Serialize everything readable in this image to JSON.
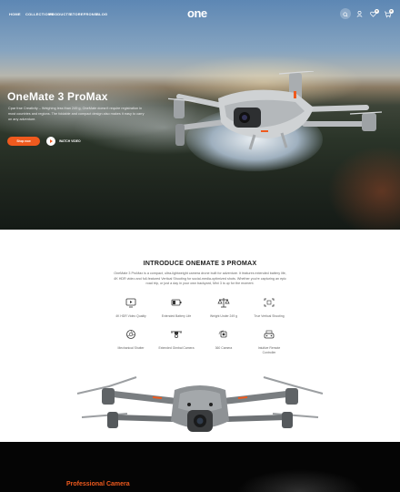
{
  "nav": {
    "links": [
      "Home",
      "Collections",
      "Products",
      "Storefrons",
      "Blog"
    ],
    "logo": "one",
    "wishlist_count": "0",
    "cart_count": "0"
  },
  "hero": {
    "title": "OneMate 3 ProMax",
    "description": "Cpar frae Creativity – Weighing less than 249 g, OneMate doesn't require registration in most countries and regions. The foldable and compact design also makes it easy to carry on any adventure.",
    "shop_button": "Shop now",
    "video_label": "Watch video",
    "slides": 3,
    "active_slide": 0
  },
  "intro": {
    "title": "INTRODUCE ONEMATE 3 PROMAX",
    "description": "OneMate 3 ProMax is a compact, ultra-lightweight camera drone built for adventure. It features extended battery life, 4K HDR video and full-featured Vertical Shooting for social-media-optimized shots. Whether you're capturing an epic road trip, or just a day in your own backyard, Mini 3 is up for the moment.",
    "features": [
      {
        "icon": "video-camera-icon",
        "label": "4K HDR Video Quality"
      },
      {
        "icon": "battery-icon",
        "label": "Extended Battery Life"
      },
      {
        "icon": "scale-icon",
        "label": "Weight Under 249 g"
      },
      {
        "icon": "frame-icon",
        "label": "True Vertical Shooting"
      },
      {
        "icon": "aperture-icon",
        "label": "Mechanical Shutter"
      },
      {
        "icon": "gimbal-drone-icon",
        "label": "Extended Gimbal Camera"
      },
      {
        "icon": "360-camera-icon",
        "label": "360 Camera"
      },
      {
        "icon": "remote-controller-icon",
        "label": "Intuitive Remote Controller"
      }
    ]
  },
  "promo": {
    "title": "Professional Camera"
  },
  "colors": {
    "accent": "#ef5a1e",
    "dark": "#050505"
  }
}
